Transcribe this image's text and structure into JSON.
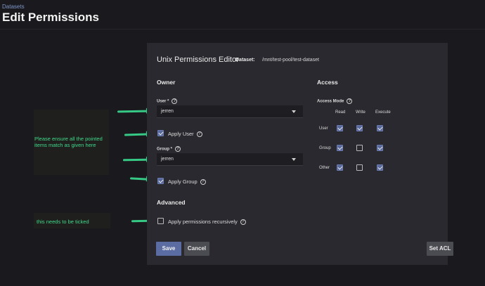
{
  "header": {
    "breadcrumb": "Datasets",
    "title": "Edit Permissions"
  },
  "annotations": {
    "note_main": "Please ensure all the pointed items match as given here",
    "note_recursive": "this needs to be ticked",
    "arrow_color": "#36c986"
  },
  "panel": {
    "title": "Unix Permissions Editor",
    "dataset_label": "Dataset:",
    "dataset_path": "/mnt/test-pool/test-dataset"
  },
  "owner": {
    "section_title": "Owner",
    "user_label": "User *",
    "user_value": "jerren",
    "apply_user_label": "Apply User",
    "apply_user_checked": true,
    "group_label": "Group *",
    "group_value": "jerren",
    "apply_group_label": "Apply Group",
    "apply_group_checked": true
  },
  "access": {
    "section_title": "Access",
    "mode_label": "Access Mode",
    "columns": [
      "Read",
      "Write",
      "Execute"
    ],
    "rows": [
      {
        "label": "User",
        "read": true,
        "write": true,
        "execute": true
      },
      {
        "label": "Group",
        "read": true,
        "write": false,
        "execute": true
      },
      {
        "label": "Other",
        "read": true,
        "write": false,
        "execute": true
      }
    ]
  },
  "advanced": {
    "section_title": "Advanced",
    "recursive_label": "Apply permissions recursively",
    "recursive_checked": false
  },
  "buttons": {
    "save": "Save",
    "cancel": "Cancel",
    "set_acl": "Set ACL"
  },
  "colors": {
    "accent": "#5b6ca2",
    "panel_bg": "#29292f",
    "page_bg": "#1a1a1e"
  }
}
